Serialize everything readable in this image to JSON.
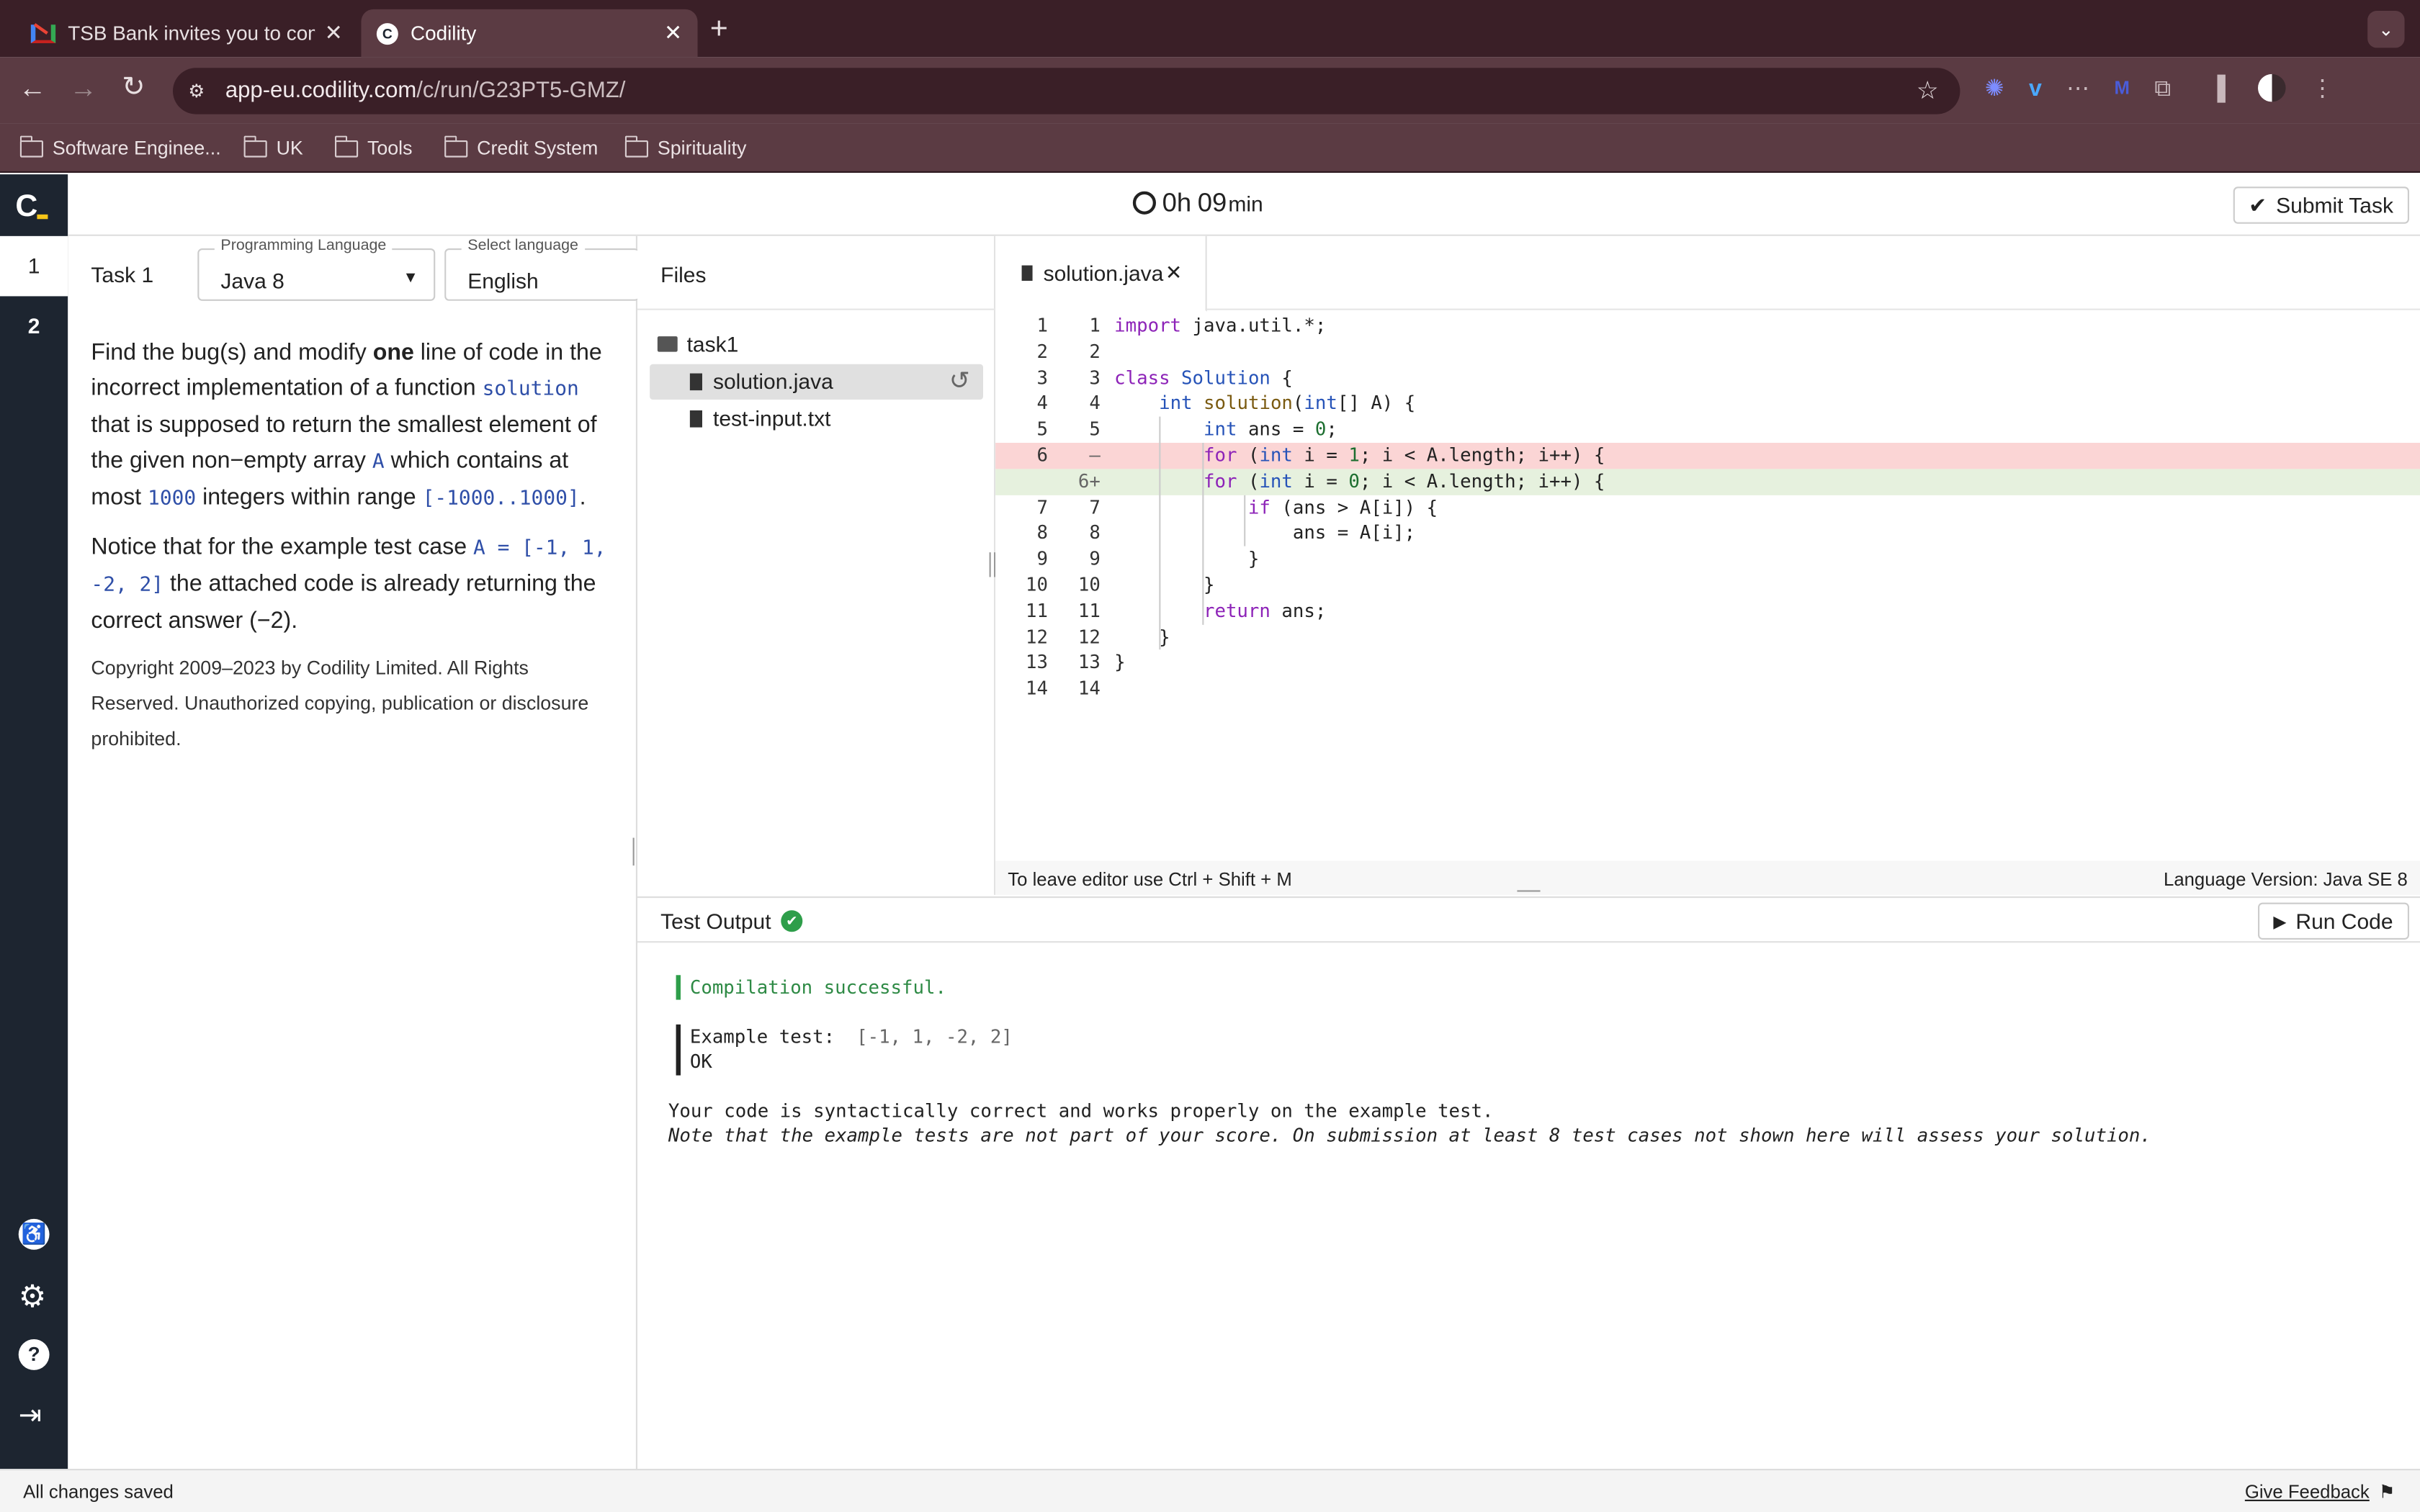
{
  "browser": {
    "tabs": [
      {
        "title": "TSB Bank invites you to comp",
        "icon": "gmail-icon"
      },
      {
        "title": "Codility",
        "icon": "codility-icon"
      }
    ],
    "url_host": "app-eu.codility.com",
    "url_path": "/c/run/G23PT5-GMZ/",
    "bookmarks": [
      "Software Enginee...",
      "UK",
      "Tools",
      "Credit System",
      "Spirituality"
    ]
  },
  "app": {
    "timer_hours": "0h",
    "timer_minutes": "09",
    "timer_unit": "min",
    "submit_label": "Submit Task",
    "task_numbers": [
      "1",
      "2"
    ],
    "task_label": "Task 1",
    "prog_lang_label": "Programming Language",
    "prog_lang_value": "Java 8",
    "lang_label": "Select language",
    "lang_value": "English"
  },
  "task": {
    "p1_a": "Find the bug(s) and modify ",
    "p1_b": "one",
    "p1_c": " line of code in the incorrect implementation of a function ",
    "p1_code1": "solution",
    "p1_d": " that is supposed to return the smallest element of the given non−empty array ",
    "p1_code2": "A",
    "p1_e": " which contains at most ",
    "p1_code3": "1000",
    "p1_f": " integers within range ",
    "p1_code4": "[-1000..1000]",
    "p1_g": ".",
    "p2_a": "Notice that for the example test case ",
    "p2_code": "A = [-1, 1, -2, 2]",
    "p2_b": " the attached code is already returning the correct answer (−2).",
    "copyright": "Copyright 2009–2023 by Codility Limited. All Rights Reserved. Unauthorized copying, publication or disclosure prohibited."
  },
  "files": {
    "title": "Files",
    "folder": "task1",
    "items": [
      "solution.java",
      "test-input.txt"
    ]
  },
  "editor": {
    "tab": "solution.java",
    "hint": "To leave editor use Ctrl + Shift + M",
    "version": "Language Version: Java SE 8",
    "lines": [
      {
        "l1": "1",
        "l2": "1",
        "text": "import java.util.*;",
        "kind": "normal"
      },
      {
        "l1": "2",
        "l2": "2",
        "text": "",
        "kind": "normal"
      },
      {
        "l1": "3",
        "l2": "3",
        "text": "class Solution {",
        "kind": "normal"
      },
      {
        "l1": "4",
        "l2": "4",
        "text": "    int solution(int[] A) {",
        "kind": "normal"
      },
      {
        "l1": "5",
        "l2": "5",
        "text": "        int ans = 0;",
        "kind": "normal"
      },
      {
        "l1": "6",
        "l2": "—",
        "text": "        for (int i = 1; i < A.length; i++) {",
        "kind": "removed"
      },
      {
        "l1": "",
        "l2": "6+",
        "text": "        for (int i = 0; i < A.length; i++) {",
        "kind": "added"
      },
      {
        "l1": "7",
        "l2": "7",
        "text": "            if (ans > A[i]) {",
        "kind": "normal"
      },
      {
        "l1": "8",
        "l2": "8",
        "text": "                ans = A[i];",
        "kind": "normal"
      },
      {
        "l1": "9",
        "l2": "9",
        "text": "            }",
        "kind": "normal"
      },
      {
        "l1": "10",
        "l2": "10",
        "text": "        }",
        "kind": "normal"
      },
      {
        "l1": "11",
        "l2": "11",
        "text": "        return ans;",
        "kind": "normal"
      },
      {
        "l1": "12",
        "l2": "12",
        "text": "    }",
        "kind": "normal"
      },
      {
        "l1": "13",
        "l2": "13",
        "text": "}",
        "kind": "normal"
      },
      {
        "l1": "14",
        "l2": "14",
        "text": "",
        "kind": "normal"
      }
    ]
  },
  "output": {
    "title": "Test Output",
    "run_label": "Run Code",
    "compile": "Compilation successful.",
    "example_label": "Example test:",
    "example_value": "[-1, 1, -2, 2]",
    "example_result": "OK",
    "summary": "Your code is syntactically correct and works properly on the example test.",
    "note": "Note that the example tests are not part of your score. On submission at least 8 test cases not shown here will assess your solution."
  },
  "status": {
    "saved": "All changes saved",
    "feedback": "Give Feedback"
  },
  "colors": {
    "browser_frame": "#3a1f27",
    "toolbar": "#5b3b43",
    "app_sidebar": "#1d2530",
    "diff_removed": "#fbd5d5",
    "diff_added": "#e6f1de",
    "success_green": "#2e9e4a"
  }
}
